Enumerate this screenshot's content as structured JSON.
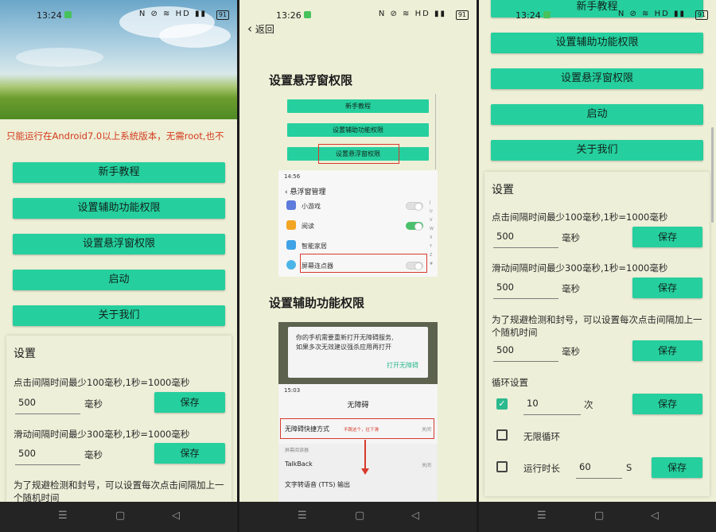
{
  "left": {
    "status": {
      "time": "13:24",
      "icons": "N ⊘ ≋ HD ▮▮",
      "battery": "91"
    },
    "notice": "只能运行在Android7.0以上系统版本，无需root,也不",
    "buttons": [
      "新手教程",
      "设置辅助功能权限",
      "设置悬浮窗权限",
      "启动",
      "关于我们"
    ],
    "settings": {
      "title": "设置",
      "click_label": "点击间隔时间最少100毫秒,1秒=1000毫秒",
      "click_value": "500",
      "unit_ms": "毫秒",
      "save": "保存",
      "slide_label": "滑动间隔时间最少300毫秒,1秒=1000毫秒",
      "slide_value": "500",
      "random_label_1": "为了规避检测和封号，可以设置每次点击间隔加上一",
      "random_label_2": "个随机时间"
    }
  },
  "middle": {
    "status": {
      "time": "13:26",
      "icons": "N ⊘ ≋ HD ▮▮",
      "battery": "91"
    },
    "back_label": "返回",
    "overlay_heading": "设置悬浮窗权限",
    "mini_buttons": [
      "新手教程",
      "设置辅助功能权限",
      "设置悬浮窗权限"
    ],
    "overlay_screen": {
      "time": "14:56",
      "title": "悬浮窗管理",
      "apps": [
        "小游戏",
        "阅读",
        "智能家居",
        "屏幕连点器"
      ],
      "alpha": [
        "J",
        "U",
        "V",
        "W",
        "X",
        "Y",
        "Z",
        "#"
      ]
    },
    "access_heading": "设置辅助功能权限",
    "dialog": {
      "message_1": "你的手机需要重新打开无障碍服务,",
      "message_2": "如果多次无效建议强杀应用再打开",
      "action": "打开无障碍"
    },
    "access_screen": {
      "time": "15:03",
      "title": "无障碍",
      "shortcut_label": "无障碍快捷方式",
      "shortcut_hint": "不跳这个，往下滑",
      "shortcut_status": "关闭",
      "section": "屏幕阅读器",
      "talkback": "TalkBack",
      "talkback_status": "关闭",
      "tts": "文字转语音 (TTS) 输出"
    }
  },
  "right": {
    "status": {
      "time": "13:24",
      "icons": "N ⊘ ≋ HD ▮▮",
      "battery": "91"
    },
    "buttons": [
      "新手教程",
      "设置辅助功能权限",
      "设置悬浮窗权限",
      "启动",
      "关于我们"
    ],
    "settings": {
      "title": "设置",
      "click_label": "点击间隔时间最少100毫秒,1秒=1000毫秒",
      "click_value": "500",
      "unit_ms": "毫秒",
      "save": "保存",
      "slide_label": "滑动间隔时间最少300毫秒,1秒=1000毫秒",
      "slide_value": "500",
      "random_label_1": "为了规避检测和封号，可以设置每次点击间隔加上一",
      "random_label_2": "个随机时间",
      "random_value": "500",
      "loop_title": "循环设置",
      "loop_count": "10",
      "loop_unit": "次",
      "infinite_label": "无限循环",
      "runtime_label": "运行时长",
      "runtime_value": "60",
      "runtime_unit": "S"
    }
  },
  "colors": {
    "accent": "#26cf9e",
    "background": "#edefd6",
    "notice": "#d43a1e",
    "highlight_box": "#d83a2e"
  }
}
